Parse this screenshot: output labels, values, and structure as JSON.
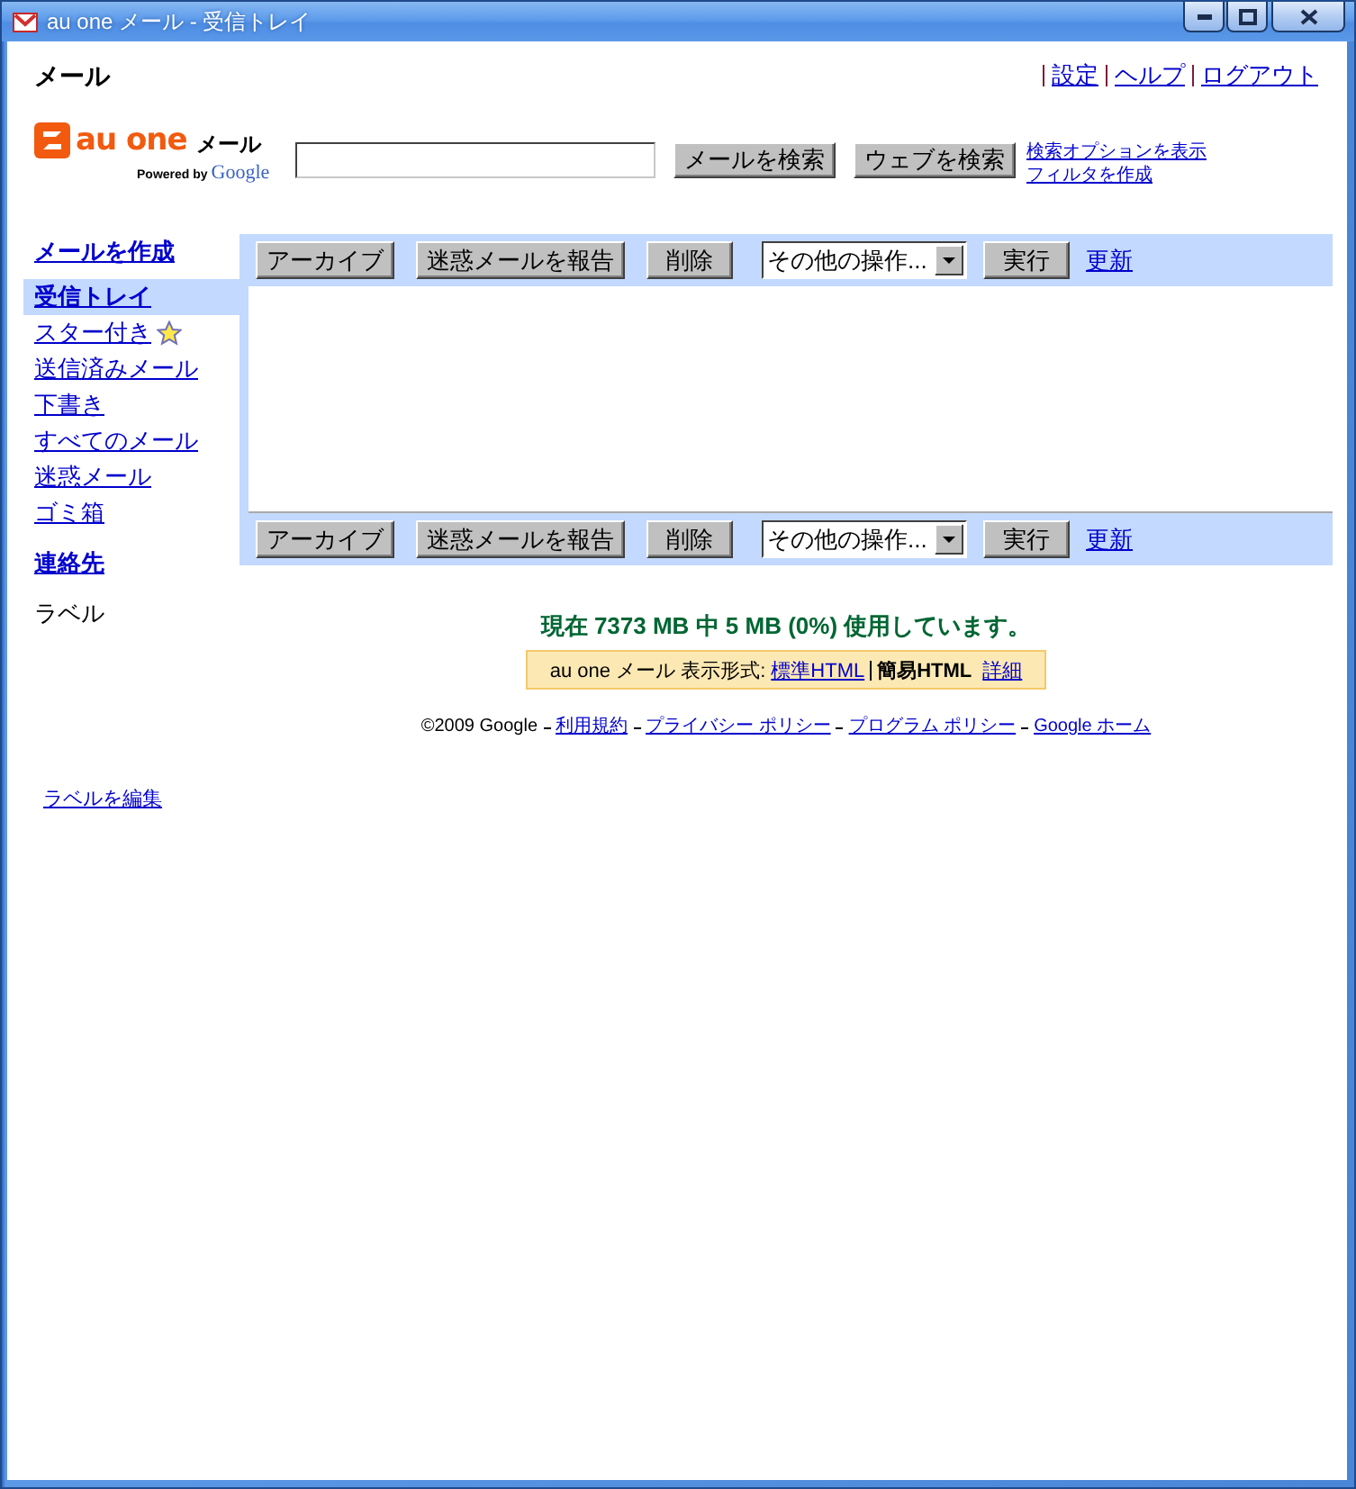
{
  "window": {
    "title": "au one メール - 受信トレイ"
  },
  "header": {
    "app_name": "メール",
    "links": [
      "設定",
      "ヘルプ",
      "ログアウト"
    ]
  },
  "logo": {
    "brand": "au one",
    "product": "メール",
    "powered_by": "Powered by",
    "google": "Google"
  },
  "search": {
    "buttons": [
      "メールを検索",
      "ウェブを検索"
    ],
    "links": [
      "検索オプションを表示",
      "フィルタを作成"
    ]
  },
  "sidebar": {
    "compose": "メールを作成",
    "folders": [
      {
        "label": "受信トレイ",
        "selected": true,
        "kind": "plain"
      },
      {
        "label": "スター付き",
        "selected": false,
        "kind": "starred"
      },
      {
        "label": "送信済みメール",
        "selected": false,
        "kind": "plain"
      },
      {
        "label": "下書き",
        "selected": false,
        "kind": "plain"
      },
      {
        "label": "すべてのメール",
        "selected": false,
        "kind": "plain"
      },
      {
        "label": "迷惑メール",
        "selected": false,
        "kind": "plain"
      },
      {
        "label": "ゴミ箱",
        "selected": false,
        "kind": "plain"
      }
    ],
    "contacts": "連絡先",
    "labels_heading": "ラベル",
    "edit_labels": "ラベルを編集"
  },
  "toolbars": [
    {
      "buttons": [
        "アーカイブ",
        "迷惑メールを報告",
        "削除"
      ],
      "more_actions": "その他の操作...",
      "go": "実行",
      "refresh": "更新"
    },
    {
      "buttons": [
        "アーカイブ",
        "迷惑メールを報告",
        "削除"
      ],
      "more_actions": "その他の操作...",
      "go": "実行",
      "refresh": "更新"
    }
  ],
  "quota": "現在 7373 MB 中 5 MB (0%) 使用しています。",
  "view_bar": {
    "label": "au one メール 表示形式:",
    "modes": [
      {
        "label": "標準HTML",
        "selected": false
      },
      {
        "label": "簡易HTML",
        "selected": true
      }
    ],
    "details": "詳細"
  },
  "footer": {
    "copyright": "©2009 Google",
    "links": [
      "利用規約",
      "プライバシー ポリシー",
      "プログラム ポリシー",
      "Google ホーム"
    ]
  }
}
